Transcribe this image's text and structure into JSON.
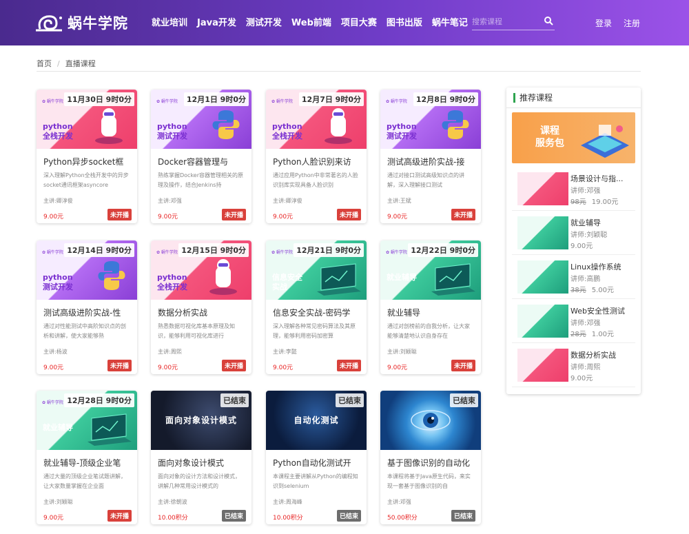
{
  "header": {
    "logo_text": "蜗牛学院",
    "nav": [
      "就业培训",
      "Java开发",
      "测试开发",
      "Web前端",
      "项目大赛",
      "图书出版",
      "蜗牛笔记"
    ],
    "search_placeholder": "搜索课程",
    "login": "登录",
    "register": "注册"
  },
  "breadcrumb": {
    "home": "首页",
    "sep": "/",
    "current": "直播课程"
  },
  "courses": [
    {
      "badge": "11月30日 9时0分",
      "thumb_title": "python\n全栈开发",
      "name": "Python异步socket框",
      "desc": "深入理解Python全栈开发中的异步socket通讯框架asyncore",
      "teacher": "主讲:卿淳俊",
      "price": "9.00元",
      "status": "未开播"
    },
    {
      "badge": "12月1日 9时0分",
      "thumb_title": "python\n测试开发",
      "name": "Docker容器管理与",
      "desc": "熟练掌握Docker容器管理相关的原理及操作，结合Jenkins持",
      "teacher": "主讲:邓强",
      "price": "9.00元",
      "status": "未开播"
    },
    {
      "badge": "12月7日 9时0分",
      "thumb_title": "python\n全栈开发",
      "name": "Python人脸识别来访",
      "desc": "通过应用Python中非常著名的人脸识别库实现具备人脸识别",
      "teacher": "主讲:卿淳俊",
      "price": "9.00元",
      "status": "未开播"
    },
    {
      "badge": "12月8日 9时0分",
      "thumb_title": "python\n测试开发",
      "name": "测试高级进阶实战-接",
      "desc": "通过对接口测试高级知识点的讲解，深入理解接口测试",
      "teacher": "主讲:王斌",
      "price": "9.00元",
      "status": "未开播"
    },
    {
      "badge": "12月14日 9时0分",
      "thumb_title": "python\n测试开发",
      "name": "测试高级进阶实战-性",
      "desc": "通过对性能测试中高阶知识点的剖析和讲解，使大家能够熟",
      "teacher": "主讲:杨波",
      "price": "9.00元",
      "status": "未开播"
    },
    {
      "badge": "12月15日 9时0分",
      "thumb_title": "python\n全栈开发",
      "name": "数据分析实战",
      "desc": "熟悉数据可视化库基本原理及知识，能够利用可视化库进行",
      "teacher": "主讲:周熙",
      "price": "9.00元",
      "status": "未开播"
    },
    {
      "badge": "12月21日 9时0分",
      "thumb_title": "信息安全\n实战",
      "name": "信息安全实战-密码学",
      "desc": "深入理解各种常见密码算法及其原理，能够利用密码加密算",
      "teacher": "主讲:李懿",
      "price": "9.00元",
      "status": "未开播"
    },
    {
      "badge": "12月22日 9时0分",
      "thumb_title": "就业辅导",
      "name": "就业辅导",
      "desc": "通过对剖榜前的自我分析，让大家能够清楚地认识自身存在",
      "teacher": "主讲:刘颖聪",
      "price": "9.00元",
      "status": "未开播"
    },
    {
      "badge": "12月28日 9时0分",
      "thumb_title": "就业辅导",
      "name": "就业辅导-顶级企业笔",
      "desc": "通过大量的顶级企业笔试题讲解，让大家数量掌握在企业面",
      "teacher": "主讲:刘颖聪",
      "price": "9.00元",
      "status": "未开播"
    },
    {
      "badge": "已结束",
      "thumb_title": "面向对象设计模式",
      "name": "面向对象设计模式",
      "desc": "面向对象的设计方法和设计模式，讲解几种常用设计模式的",
      "teacher": "主讲:徐朝波",
      "price": "10.00积分",
      "status": "已结束"
    },
    {
      "badge": "已结束",
      "thumb_title": "自动化测试",
      "name": "Python自动化测试开",
      "desc": "本课程主要讲解从Python的编程知识到selenium",
      "teacher": "主讲:周海峰",
      "price": "10.00积分",
      "status": "已结束"
    },
    {
      "badge": "已结束",
      "thumb_title": "",
      "name": "基于图像识别的自动化",
      "desc": "本课程将基于Java原生代码，来实现一套基于图像识别的自",
      "teacher": "主讲:邓强",
      "price": "50.00积分",
      "status": "已结束"
    }
  ],
  "sidebar": {
    "title": "推荐课程",
    "banner_text": "课程\n服务包",
    "items": [
      {
        "name": "场景设计与指...",
        "teacher": "讲师:邓强",
        "old_price": "98元",
        "price": "19.00元"
      },
      {
        "name": "就业辅导",
        "teacher": "讲师:刘颖聪",
        "old_price": "",
        "price": "9.00元"
      },
      {
        "name": "Linux操作系统",
        "teacher": "讲师:高鹏",
        "old_price": "38元",
        "price": "5.00元"
      },
      {
        "name": "Web安全性测试",
        "teacher": "讲师:邓强",
        "old_price": "28元",
        "price": "1.00元"
      },
      {
        "name": "数据分析实战",
        "teacher": "讲师:周熙",
        "old_price": "",
        "price": "9.00元"
      }
    ]
  },
  "colors": {
    "accent": "#6f3cc7",
    "price": "#e82424",
    "status_live": "#d9413b",
    "status_done": "#6d6d6d"
  }
}
